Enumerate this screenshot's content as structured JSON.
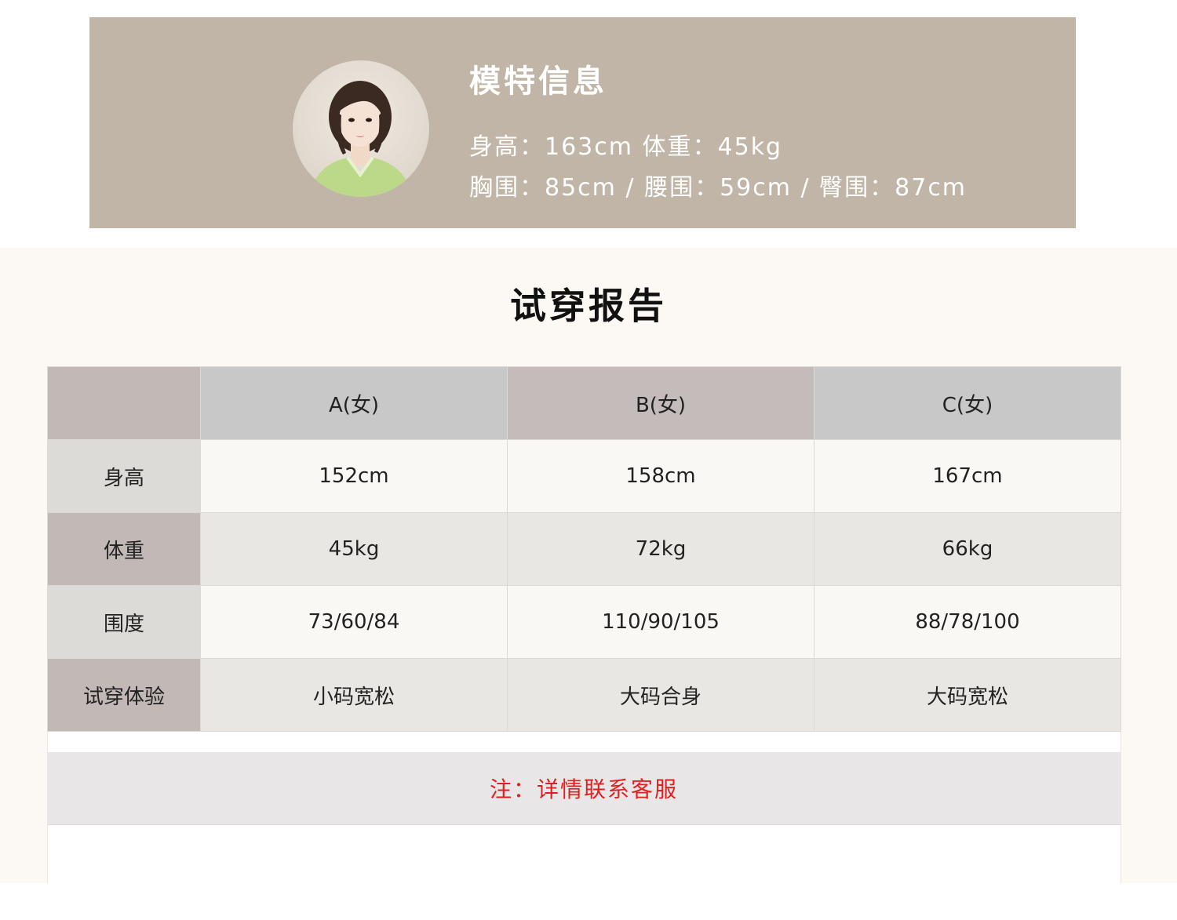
{
  "model_info": {
    "title": "模特信息",
    "line1": "身高：163cm  体重：45kg",
    "line2": "胸围：85cm / 腰围：59cm / 臀围：87cm"
  },
  "report": {
    "title": "试穿报告",
    "columns": [
      "",
      "A(女)",
      "B(女)",
      "C(女)"
    ],
    "rows": [
      {
        "label": "身高",
        "values": [
          "152cm",
          "158cm",
          "167cm"
        ]
      },
      {
        "label": "体重",
        "values": [
          "45kg",
          "72kg",
          "66kg"
        ]
      },
      {
        "label": "围度",
        "values": [
          "73/60/84",
          "110/90/105",
          "88/78/100"
        ]
      },
      {
        "label": "试穿体验",
        "values": [
          "小码宽松",
          "大码合身",
          "大码宽松"
        ]
      }
    ],
    "note": "注：详情联系客服"
  },
  "colors": {
    "banner_bg": "#c0b5a6",
    "report_bg": "#fcf8f3",
    "note_color": "#e02020"
  }
}
